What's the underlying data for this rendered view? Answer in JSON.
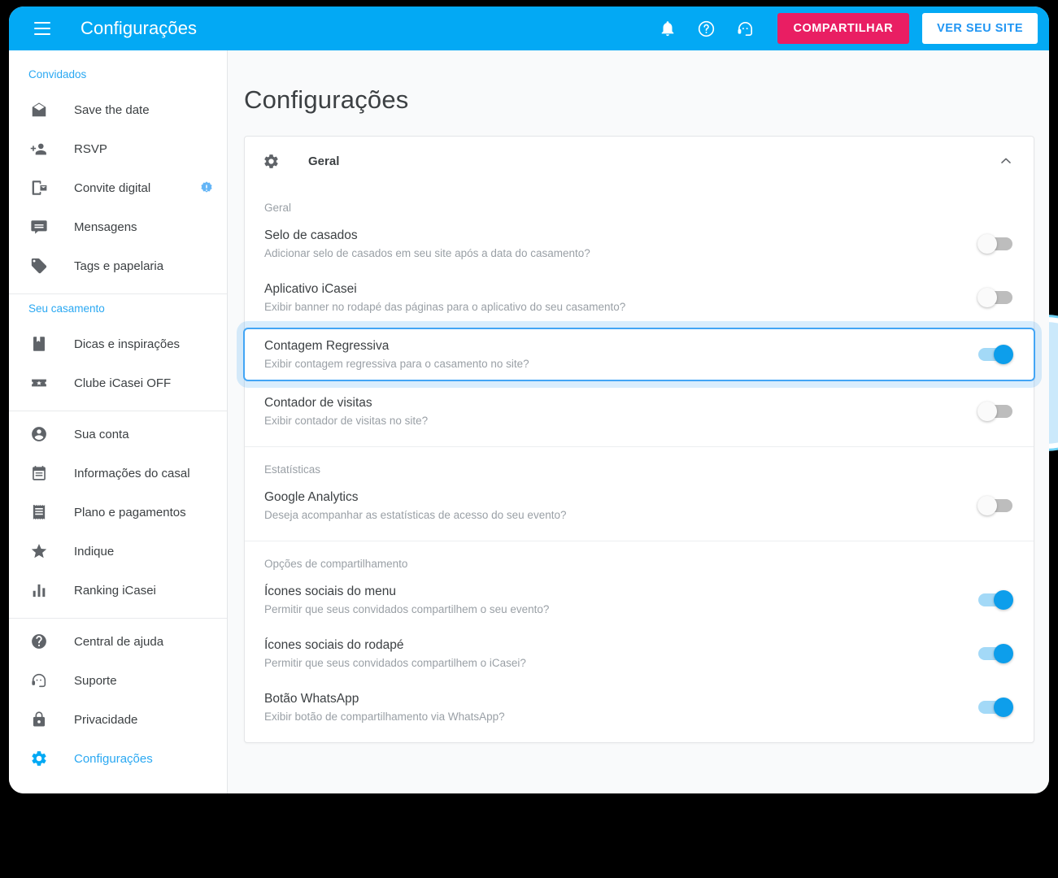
{
  "topbar": {
    "menu_icon": "hamburger-icon",
    "title": "Configurações",
    "icons": [
      "bell-icon",
      "help-circle-icon",
      "headset-icon"
    ],
    "share_label": "COMPARTILHAR",
    "view_site_label": "VER SEU SITE",
    "accent_blue": "#03a9f4",
    "share_pink": "#e91e63"
  },
  "sidebar": {
    "groups": [
      {
        "header": "Convidados",
        "items": [
          {
            "label": "Save the date",
            "icon": "mail-open-icon",
            "badge": null,
            "active": false
          },
          {
            "label": "RSVP",
            "icon": "person-add-icon",
            "badge": null,
            "active": false
          },
          {
            "label": "Convite digital",
            "icon": "mobile-invite-icon",
            "badge": "alert-badge-icon",
            "active": false
          },
          {
            "label": "Mensagens",
            "icon": "message-icon",
            "badge": null,
            "active": false
          },
          {
            "label": "Tags e papelaria",
            "icon": "tag-icon",
            "badge": null,
            "active": false
          }
        ]
      },
      {
        "header": "Seu casamento",
        "items": [
          {
            "label": "Dicas e inspirações",
            "icon": "book-icon",
            "badge": null,
            "active": false
          },
          {
            "label": "Clube iCasei OFF",
            "icon": "ticket-star-icon",
            "badge": null,
            "active": false
          }
        ]
      },
      {
        "header": null,
        "items": [
          {
            "label": "Sua conta",
            "icon": "account-circle-icon",
            "badge": null,
            "active": false
          },
          {
            "label": "Informações do casal",
            "icon": "calendar-note-icon",
            "badge": null,
            "active": false
          },
          {
            "label": "Plano e pagamentos",
            "icon": "receipt-icon",
            "badge": null,
            "active": false
          },
          {
            "label": "Indique",
            "icon": "star-icon",
            "badge": null,
            "active": false
          },
          {
            "label": "Ranking iCasei",
            "icon": "bar-chart-icon",
            "badge": null,
            "active": false
          }
        ]
      },
      {
        "header": null,
        "items": [
          {
            "label": "Central de ajuda",
            "icon": "help-filled-icon",
            "badge": null,
            "active": false
          },
          {
            "label": "Suporte",
            "icon": "headset-icon",
            "badge": null,
            "active": false
          },
          {
            "label": "Privacidade",
            "icon": "lock-icon",
            "badge": null,
            "active": false
          },
          {
            "label": "Configurações",
            "icon": "gear-icon",
            "badge": null,
            "active": true
          }
        ]
      }
    ]
  },
  "main": {
    "page_title": "Configurações",
    "card": {
      "header_icon": "gear-icon",
      "header_title": "Geral",
      "collapse_icon": "chevron-up-icon",
      "sections": [
        {
          "label": "Geral",
          "rows": [
            {
              "title": "Selo de casados",
              "subtitle": "Adicionar selo de casados em seu site após a data do casamento?",
              "state": "off",
              "highlighted": false
            },
            {
              "title": "Aplicativo iCasei",
              "subtitle": "Exibir banner no rodapé das páginas para o aplicativo do seu casamento?",
              "state": "off",
              "highlighted": false
            },
            {
              "title": "Contagem Regressiva",
              "subtitle": "Exibir contagem regressiva para o casamento no site?",
              "state": "on",
              "highlighted": true
            },
            {
              "title": "Contador de visitas",
              "subtitle": "Exibir contador de visitas no site?",
              "state": "off",
              "highlighted": false
            }
          ]
        },
        {
          "label": "Estatísticas",
          "rows": [
            {
              "title": "Google Analytics",
              "subtitle": "Deseja acompanhar as estatísticas de acesso do seu evento?",
              "state": "off",
              "highlighted": false
            }
          ]
        },
        {
          "label": "Opções de compartilhamento",
          "rows": [
            {
              "title": "Ícones sociais do menu",
              "subtitle": "Permitir que seus convidados compartilhem o seu evento?",
              "state": "on",
              "highlighted": false
            },
            {
              "title": "Ícones sociais do rodapé",
              "subtitle": "Permitir que seus convidados compartilhem o iCasei?",
              "state": "on",
              "highlighted": false
            },
            {
              "title": "Botão WhatsApp",
              "subtitle": "Exibir botão de compartilhamento via WhatsApp?",
              "state": "on",
              "highlighted": false
            }
          ]
        }
      ]
    }
  },
  "decoration": {
    "circle_color": "#cbe9fb",
    "circle_ring_color": "#6fd2f5"
  }
}
